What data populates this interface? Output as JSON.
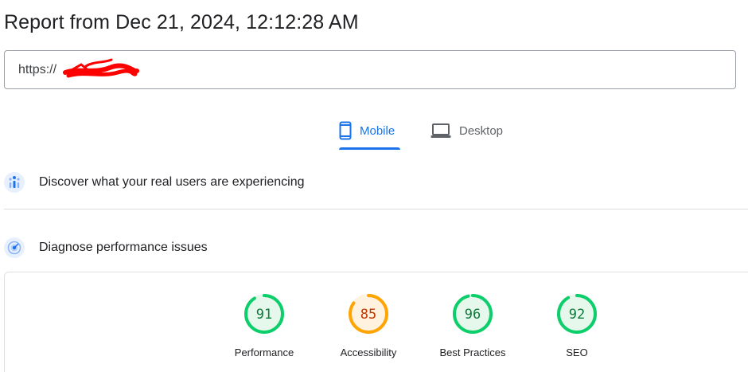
{
  "report": {
    "title": "Report from Dec 21, 2024, 12:12:28 AM"
  },
  "url_field": {
    "value_prefix": "https://"
  },
  "device_tabs": [
    {
      "label": "Mobile",
      "icon": "smartphone-icon",
      "selected": true
    },
    {
      "label": "Desktop",
      "icon": "laptop-icon",
      "selected": false
    }
  ],
  "sections": {
    "real_users": {
      "label": "Discover what your real users are experiencing",
      "icon": "field-data-icon"
    },
    "diagnose": {
      "label": "Diagnose performance issues",
      "icon": "lab-data-icon"
    }
  },
  "scores": [
    {
      "label": "Performance",
      "value": "91",
      "status": "good"
    },
    {
      "label": "Accessibility",
      "value": "85",
      "status": "average"
    },
    {
      "label": "Best Practices",
      "value": "96",
      "status": "good"
    },
    {
      "label": "SEO",
      "value": "92",
      "status": "good"
    }
  ],
  "colors": {
    "accent": "#1a73e8",
    "good_stroke": "#0cce6b",
    "good_fill": "#e6f7ec",
    "good_text": "#0b7a3a",
    "average_stroke": "#ffa400",
    "average_fill": "#fff3e0",
    "average_text": "#c33300",
    "redaction": "#ff0000"
  }
}
